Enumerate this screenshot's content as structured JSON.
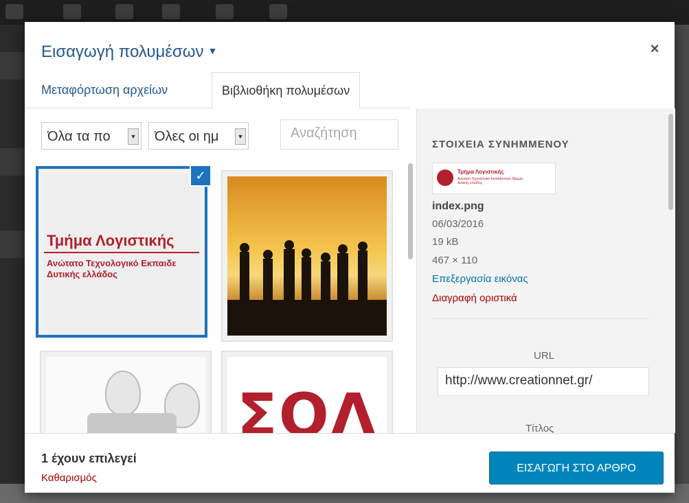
{
  "modal": {
    "title": "Εισαγωγή πολυμέσων",
    "close_glyph": "×"
  },
  "tabs": [
    {
      "label": "Μεταφόρτωση αρχείων"
    },
    {
      "label": "Βιβλιοθήκη πολυμέσων"
    }
  ],
  "filters": {
    "type_select": "Όλα τα πο",
    "date_select": "Όλες οι ημ",
    "search_placeholder": "Αναζήτηση"
  },
  "attachments": [
    {
      "title": "Τμήμα Λογιστικής",
      "subtitle_line1": "Ανώτατο Τεχνολογικό Εκπαιδε",
      "subtitle_line2": "Δυτικής ελλάδος",
      "selected": true,
      "check_glyph": "✓"
    },
    {
      "icon": "sunset-people-jumping-image",
      "selected": false
    },
    {
      "icon": "lightbulbs-gears-image",
      "selected": false
    },
    {
      "text": "ΣΟΛ",
      "selected": false
    }
  ],
  "details": {
    "heading": "ΣΤΟΙΧΕΙΑ ΣΥΝΗΜΜΕΝΟΥ",
    "thumb_title": "Τμήμα Λογιστικής",
    "thumb_sub1": "Ανώτατο Τεχνολογικό Εκπαιδευτικό Ίδρυμα",
    "thumb_sub2": "Δυτικής ελλάδος",
    "filename": "index.png",
    "date": "06/03/2016",
    "size": "19 kB",
    "dimensions": "467 × 110",
    "edit_link": "Επεξεργασία εικόνας",
    "delete_link": "Διαγραφή οριστικά",
    "url_label": "URL",
    "url_value": "http://www.creationnet.gr/",
    "title_label": "Τίτλος"
  },
  "footer": {
    "selected_count": "1 έχουν επιλεγεί",
    "clear_link": "Καθαρισμός",
    "insert_button": "ΕΙΣΑΓΩΓΗ ΣΤΟ ΑΡΘΡΟ"
  },
  "colors": {
    "accent": "#0085ba",
    "link": "#0073aa",
    "danger": "#aa0000",
    "brand_red": "#b21f2d",
    "selection": "#1e73be"
  }
}
